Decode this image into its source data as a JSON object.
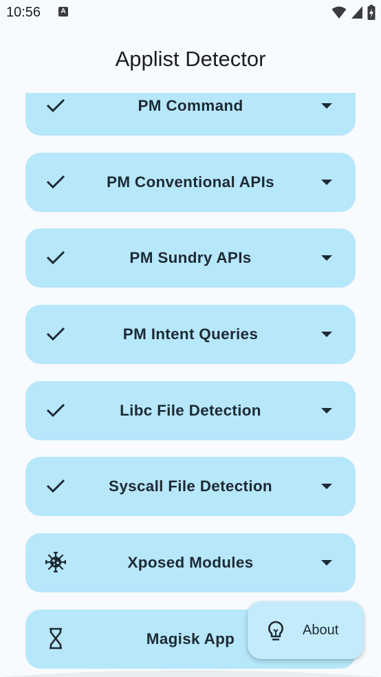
{
  "status_bar": {
    "time": "10:56",
    "notification_glyph": "A"
  },
  "app": {
    "title": "Applist Detector"
  },
  "cards": [
    {
      "label": "PM Command",
      "icon": "check-icon"
    },
    {
      "label": "PM Conventional APIs",
      "icon": "check-icon"
    },
    {
      "label": "PM Sundry APIs",
      "icon": "check-icon"
    },
    {
      "label": "PM Intent Queries",
      "icon": "check-icon"
    },
    {
      "label": "Libc File Detection",
      "icon": "check-icon"
    },
    {
      "label": "Syscall File Detection",
      "icon": "check-icon"
    },
    {
      "label": "Xposed Modules",
      "icon": "virus-icon"
    },
    {
      "label": "Magisk App",
      "icon": "hourglass-icon"
    }
  ],
  "fab": {
    "label": "About",
    "icon": "lightbulb-icon"
  },
  "colors": {
    "background": "#f8fbfe",
    "card": "#b7e7fb",
    "fab": "#c3ebfb",
    "text": "#1d2a33"
  }
}
